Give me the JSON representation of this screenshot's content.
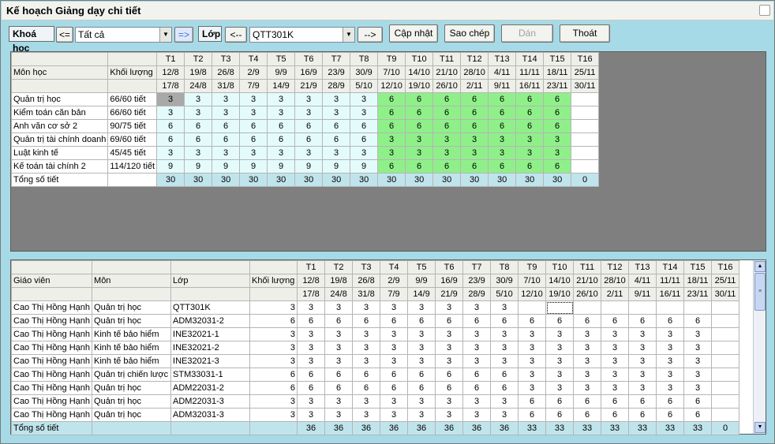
{
  "window": {
    "title": "Kế hoạch Giảng dạy chi tiết"
  },
  "toolbar": {
    "khoa_label": "Khoá học",
    "prev_khoa": "<=",
    "khoa_value": "Tất cả",
    "next_khoa": "=>",
    "lop_label": "Lớp",
    "prev_lop": "<--",
    "lop_value": "QTT301K",
    "next_lop": "-->",
    "update": "Cập nhật",
    "copy": "Sao chép",
    "paste": "Dán",
    "exit": "Thoát"
  },
  "weeks": [
    {
      "t": "T1",
      "s": "12/8",
      "e": "17/8"
    },
    {
      "t": "T2",
      "s": "19/8",
      "e": "24/8"
    },
    {
      "t": "T3",
      "s": "26/8",
      "e": "31/8"
    },
    {
      "t": "T4",
      "s": "2/9",
      "e": "7/9"
    },
    {
      "t": "T5",
      "s": "9/9",
      "e": "14/9"
    },
    {
      "t": "T6",
      "s": "16/9",
      "e": "21/9"
    },
    {
      "t": "T7",
      "s": "23/9",
      "e": "28/9"
    },
    {
      "t": "T8",
      "s": "30/9",
      "e": "5/10"
    },
    {
      "t": "T9",
      "s": "7/10",
      "e": "12/10"
    },
    {
      "t": "T10",
      "s": "14/10",
      "e": "19/10"
    },
    {
      "t": "T11",
      "s": "21/10",
      "e": "26/10"
    },
    {
      "t": "T12",
      "s": "28/10",
      "e": "2/11"
    },
    {
      "t": "T13",
      "s": "4/11",
      "e": "9/11"
    },
    {
      "t": "T14",
      "s": "11/11",
      "e": "16/11"
    },
    {
      "t": "T15",
      "s": "18/11",
      "e": "23/11"
    },
    {
      "t": "T16",
      "s": "25/11",
      "e": "30/11"
    }
  ],
  "top": {
    "headers": {
      "subject": "Môn học",
      "load": "Khối lượng"
    },
    "rows": [
      {
        "subject": "Quản trị học",
        "load": "66/60 tiết",
        "v": [
          "3",
          "3",
          "3",
          "3",
          "3",
          "3",
          "3",
          "3",
          "6",
          "6",
          "6",
          "6",
          "6",
          "6",
          "6",
          ""
        ]
      },
      {
        "subject": "Kiểm toán căn bản",
        "load": "66/60 tiết",
        "v": [
          "3",
          "3",
          "3",
          "3",
          "3",
          "3",
          "3",
          "3",
          "6",
          "6",
          "6",
          "6",
          "6",
          "6",
          "6",
          ""
        ]
      },
      {
        "subject": "Anh văn cơ sở 2",
        "load": "90/75 tiết",
        "v": [
          "6",
          "6",
          "6",
          "6",
          "6",
          "6",
          "6",
          "6",
          "6",
          "6",
          "6",
          "6",
          "6",
          "6",
          "6",
          ""
        ]
      },
      {
        "subject": "Quản trị tài chính doanh",
        "load": "69/60 tiết",
        "v": [
          "6",
          "6",
          "6",
          "6",
          "6",
          "6",
          "6",
          "6",
          "3",
          "3",
          "3",
          "3",
          "3",
          "3",
          "3",
          ""
        ]
      },
      {
        "subject": "Luật kinh tế",
        "load": "45/45 tiết",
        "v": [
          "3",
          "3",
          "3",
          "3",
          "3",
          "3",
          "3",
          "3",
          "3",
          "3",
          "3",
          "3",
          "3",
          "3",
          "3",
          ""
        ]
      },
      {
        "subject": "Kế toán tài chính 2",
        "load": "114/120 tiết",
        "v": [
          "9",
          "9",
          "9",
          "9",
          "9",
          "9",
          "9",
          "9",
          "6",
          "6",
          "6",
          "6",
          "6",
          "6",
          "6",
          ""
        ]
      }
    ],
    "total_label": "Tổng số tiết",
    "totals": [
      "30",
      "30",
      "30",
      "30",
      "30",
      "30",
      "30",
      "30",
      "30",
      "30",
      "30",
      "30",
      "30",
      "30",
      "30",
      "0"
    ]
  },
  "bottom": {
    "headers": {
      "teacher": "Giáo viên",
      "subject": "Môn",
      "class": "Lớp",
      "load": "Khối lượng"
    },
    "rows": [
      {
        "teacher": "Cao Thị Hồng Hạnh",
        "subject": "Quản trị học",
        "class": "QTT301K",
        "load": "3",
        "v": [
          "3",
          "3",
          "3",
          "3",
          "3",
          "3",
          "3",
          "3",
          "",
          "",
          "",
          "",
          "",
          "",
          "",
          ""
        ]
      },
      {
        "teacher": "Cao Thị Hồng Hạnh",
        "subject": "Quản trị học",
        "class": "ADM32031-2",
        "load": "6",
        "v": [
          "6",
          "6",
          "6",
          "6",
          "6",
          "6",
          "6",
          "6",
          "6",
          "6",
          "6",
          "6",
          "6",
          "6",
          "6",
          ""
        ]
      },
      {
        "teacher": "Cao Thị Hồng Hạnh",
        "subject": "Kinh tế bảo hiểm",
        "class": "INE32021-1",
        "load": "3",
        "v": [
          "3",
          "3",
          "3",
          "3",
          "3",
          "3",
          "3",
          "3",
          "3",
          "3",
          "3",
          "3",
          "3",
          "3",
          "3",
          ""
        ]
      },
      {
        "teacher": "Cao Thị Hồng Hạnh",
        "subject": "Kinh tế bảo hiểm",
        "class": "INE32021-2",
        "load": "3",
        "v": [
          "3",
          "3",
          "3",
          "3",
          "3",
          "3",
          "3",
          "3",
          "3",
          "3",
          "3",
          "3",
          "3",
          "3",
          "3",
          ""
        ]
      },
      {
        "teacher": "Cao Thị Hồng Hạnh",
        "subject": "Kinh tế bảo hiểm",
        "class": "INE32021-3",
        "load": "3",
        "v": [
          "3",
          "3",
          "3",
          "3",
          "3",
          "3",
          "3",
          "3",
          "3",
          "3",
          "3",
          "3",
          "3",
          "3",
          "3",
          ""
        ]
      },
      {
        "teacher": "Cao Thị Hồng Hạnh",
        "subject": "Quản trị chiến lược",
        "class": "STM33031-1",
        "load": "6",
        "v": [
          "6",
          "6",
          "6",
          "6",
          "6",
          "6",
          "6",
          "6",
          "3",
          "3",
          "3",
          "3",
          "3",
          "3",
          "3",
          ""
        ]
      },
      {
        "teacher": "Cao Thị Hồng Hạnh",
        "subject": "Quản trị học",
        "class": "ADM22031-2",
        "load": "6",
        "v": [
          "6",
          "6",
          "6",
          "6",
          "6",
          "6",
          "6",
          "6",
          "3",
          "3",
          "3",
          "3",
          "3",
          "3",
          "3",
          ""
        ]
      },
      {
        "teacher": "Cao Thị Hồng Hạnh",
        "subject": "Quản trị học",
        "class": "ADM22031-3",
        "load": "3",
        "v": [
          "3",
          "3",
          "3",
          "3",
          "3",
          "3",
          "3",
          "3",
          "6",
          "6",
          "6",
          "6",
          "6",
          "6",
          "6",
          ""
        ]
      },
      {
        "teacher": "Cao Thị Hồng Hạnh",
        "subject": "Quản trị học",
        "class": "ADM32031-3",
        "load": "3",
        "v": [
          "3",
          "3",
          "3",
          "3",
          "3",
          "3",
          "3",
          "3",
          "6",
          "6",
          "6",
          "6",
          "6",
          "6",
          "6",
          ""
        ]
      }
    ],
    "total_label": "Tổng số tiết",
    "totals": [
      "36",
      "36",
      "36",
      "36",
      "36",
      "36",
      "36",
      "36",
      "33",
      "33",
      "33",
      "33",
      "33",
      "33",
      "33",
      "0"
    ]
  }
}
